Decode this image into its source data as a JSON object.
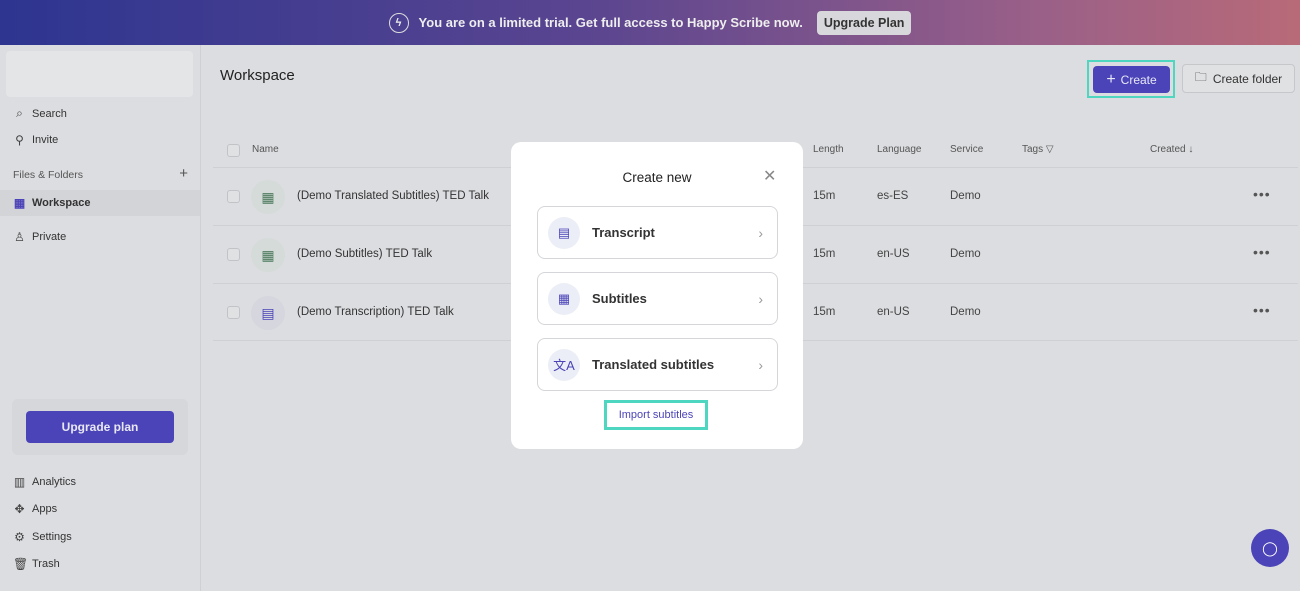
{
  "banner": {
    "text": "You are on a limited trial. Get full access to Happy Scribe now.",
    "button": "Upgrade Plan"
  },
  "sidebar": {
    "search": "Search",
    "invite": "Invite",
    "section": "Files & Folders",
    "workspace": "Workspace",
    "private": "Private",
    "upgrade": "Upgrade plan",
    "analytics": "Analytics",
    "apps": "Apps",
    "settings": "Settings",
    "trash": "Trash"
  },
  "header": {
    "title": "Workspace",
    "create": "Create",
    "create_folder": "Create folder"
  },
  "table": {
    "columns": {
      "name": "Name",
      "length": "Length",
      "language": "Language",
      "service": "Service",
      "tags": "Tags",
      "created": "Created"
    },
    "rows": [
      {
        "name": "(Demo Translated Subtitles) TED Talk",
        "length": "15m",
        "language": "es-ES",
        "service": "Demo",
        "icon": "film-icon"
      },
      {
        "name": "(Demo Subtitles) TED Talk",
        "length": "15m",
        "language": "en-US",
        "service": "Demo",
        "icon": "film-icon"
      },
      {
        "name": "(Demo Transcription) TED Talk",
        "length": "15m",
        "language": "en-US",
        "service": "Demo",
        "icon": "document-icon"
      }
    ]
  },
  "modal": {
    "title": "Create new",
    "options": [
      "Transcript",
      "Subtitles",
      "Translated subtitles"
    ],
    "import": "Import subtitles"
  },
  "colors": {
    "accent": "#4b44b8",
    "highlight": "#4fd6c0"
  }
}
